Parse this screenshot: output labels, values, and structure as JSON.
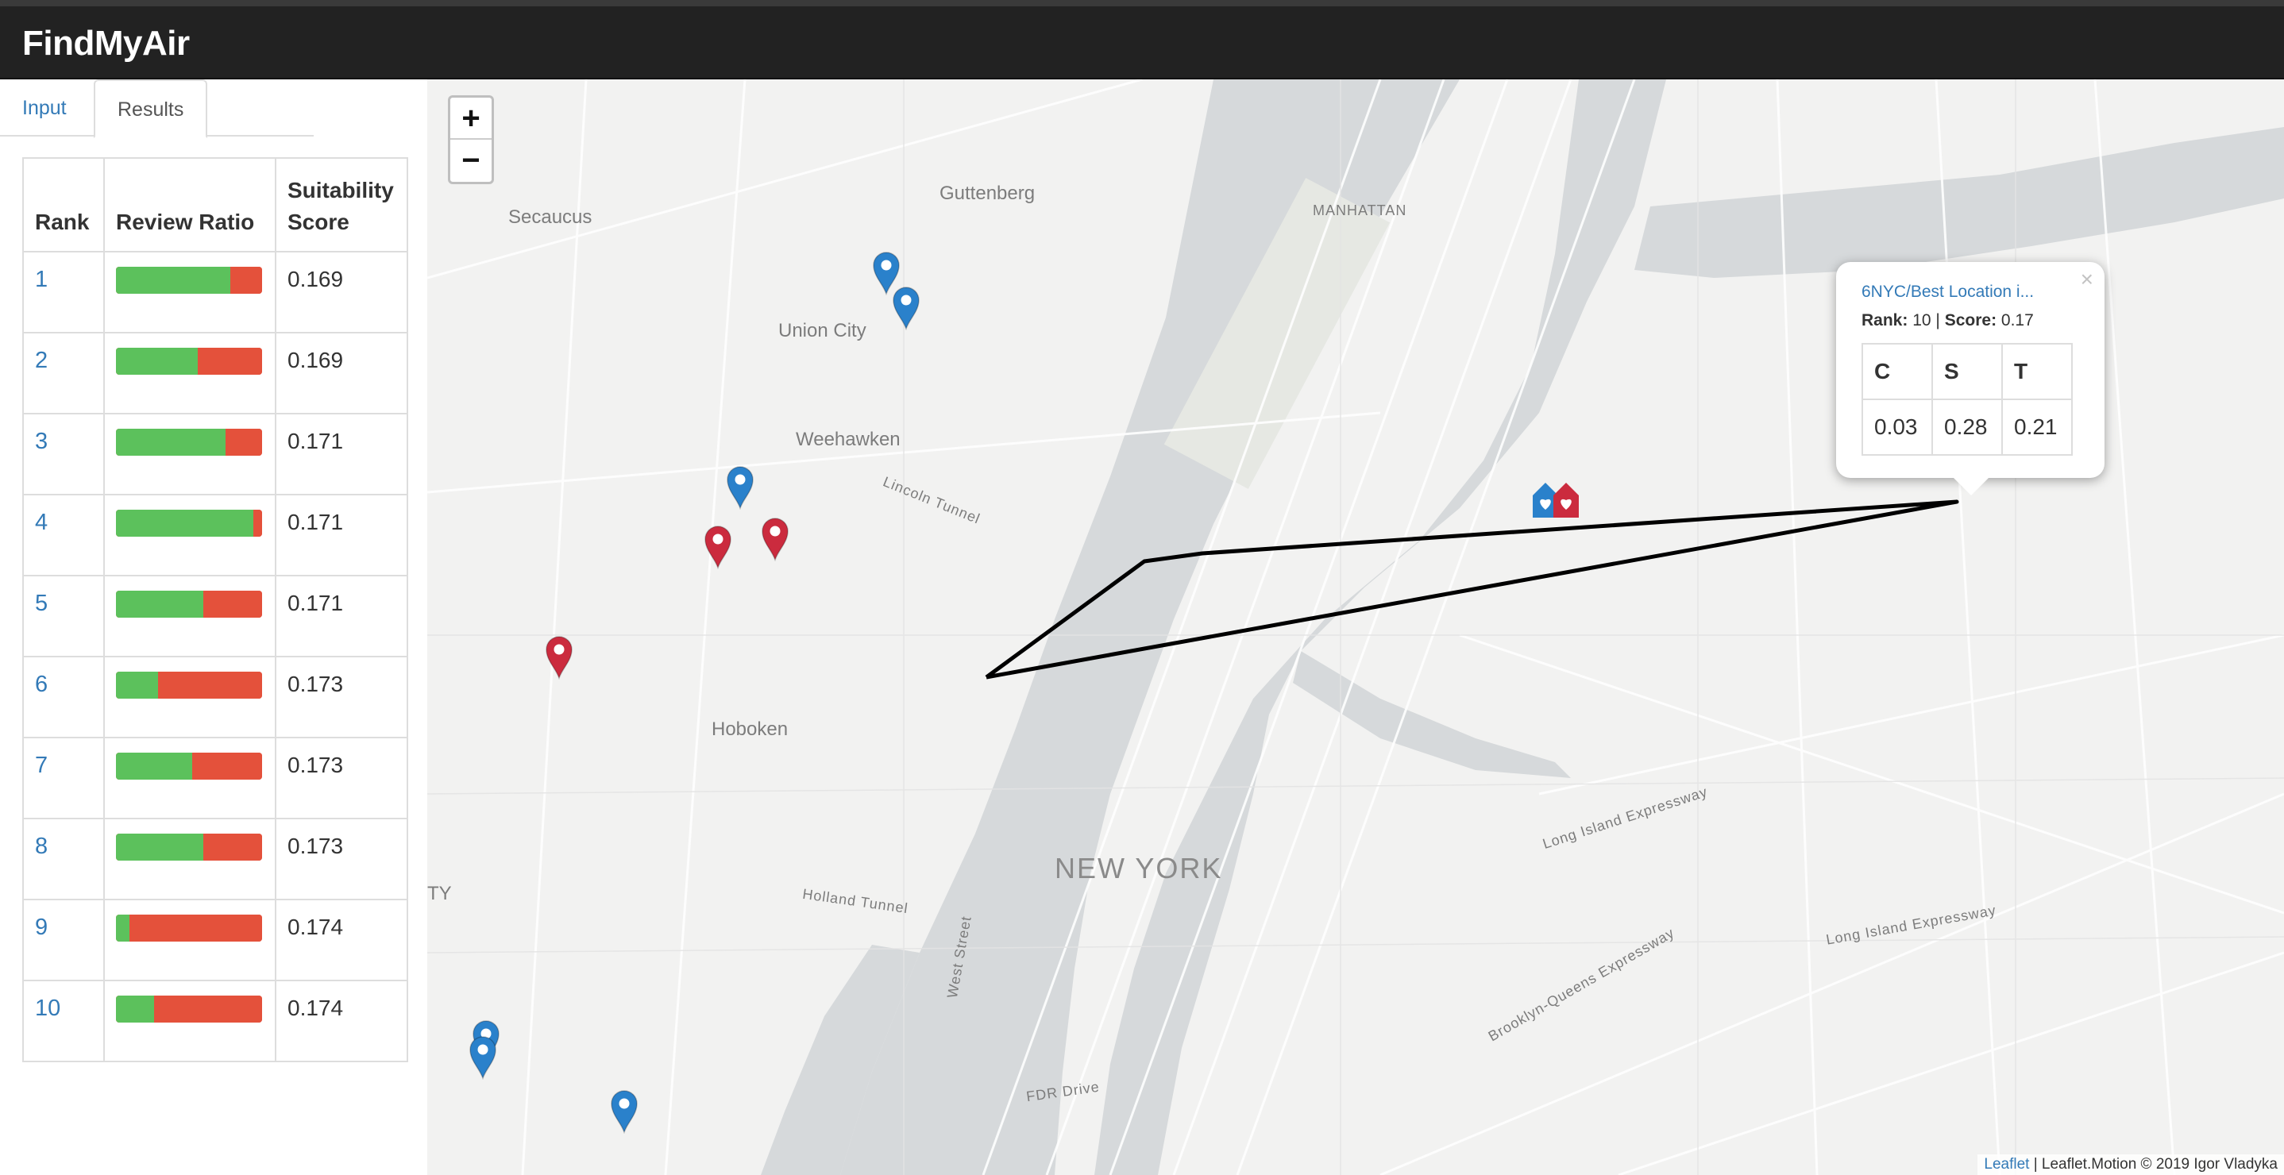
{
  "app": {
    "title": "FindMyAir"
  },
  "tabs": [
    {
      "label": "Input"
    },
    {
      "label": "Results"
    }
  ],
  "results_table": {
    "headers": [
      "Rank",
      "Review Ratio",
      "Suitability Score"
    ],
    "rows": [
      {
        "rank": "1",
        "positive_ratio": 0.78,
        "score": "0.169"
      },
      {
        "rank": "2",
        "positive_ratio": 0.56,
        "score": "0.169"
      },
      {
        "rank": "3",
        "positive_ratio": 0.75,
        "score": "0.171"
      },
      {
        "rank": "4",
        "positive_ratio": 0.94,
        "score": "0.171"
      },
      {
        "rank": "5",
        "positive_ratio": 0.6,
        "score": "0.171"
      },
      {
        "rank": "6",
        "positive_ratio": 0.29,
        "score": "0.173"
      },
      {
        "rank": "7",
        "positive_ratio": 0.52,
        "score": "0.173"
      },
      {
        "rank": "8",
        "positive_ratio": 0.6,
        "score": "0.173"
      },
      {
        "rank": "9",
        "positive_ratio": 0.09,
        "score": "0.174"
      },
      {
        "rank": "10",
        "positive_ratio": 0.26,
        "score": "0.174"
      }
    ]
  },
  "map": {
    "zoom_in": "+",
    "zoom_out": "−",
    "labels": {
      "secaucus": "Secaucus",
      "guttenberg": "Guttenberg",
      "manhattan": "MANHATTAN",
      "union_city": "Union City",
      "weehawken": "Weehawken",
      "hoboken": "Hoboken",
      "new_york": "NEW YORK",
      "ty": "TY",
      "long_island_expressway": "Long Island Expressway",
      "holland_tunnel": "Holland Tunnel",
      "fdr_drive": "FDR Drive",
      "lincoln_tunnel": "Lincoln Tunnel",
      "west_street": "West Street",
      "brooklyn_queens_expressway": "Brooklyn-Queens Expressway"
    },
    "popup": {
      "title": "6NYC/Best Location i...",
      "rank_label": "Rank:",
      "rank_value": "10",
      "separator": "|",
      "score_label": "Score:",
      "score_value": "0.17",
      "close": "×",
      "table_headers": [
        "C",
        "S",
        "T"
      ],
      "table_values": [
        "0.03",
        "0.28",
        "0.21"
      ]
    },
    "attribution": {
      "leaflet": "Leaflet",
      "rest": "| Leaflet.Motion © 2019 Igor Vladyka"
    },
    "colors": {
      "blue_marker": "#2a81cb",
      "red_marker": "#cb2b3e",
      "route": "#000000"
    }
  }
}
